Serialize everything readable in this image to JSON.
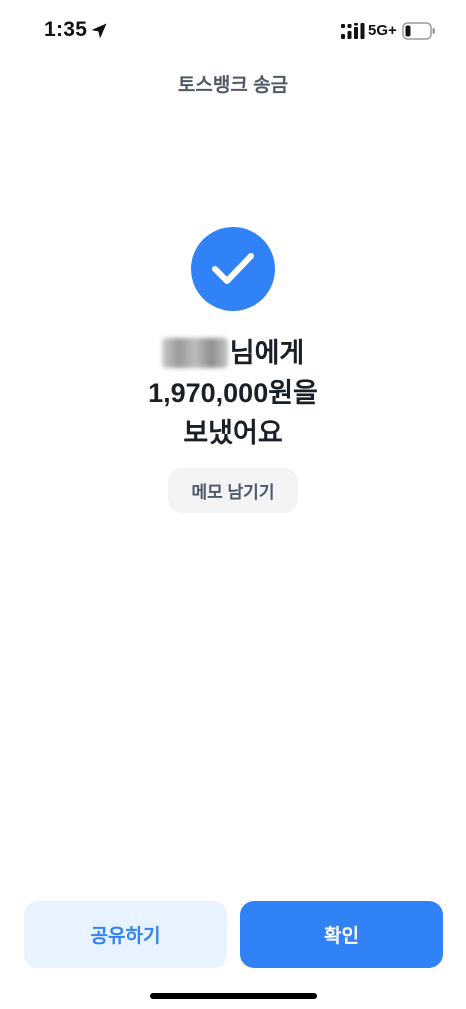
{
  "status_bar": {
    "time": "1:35",
    "network": "5G+",
    "battery_level": 0.2,
    "location_icon": "location-arrow-icon",
    "signal_icon": "cellular-signal-icon",
    "battery_icon": "battery-low-icon"
  },
  "header": {
    "title": "토스뱅크 송금"
  },
  "success": {
    "icon": "check-icon",
    "recipient_name": "",
    "recipient_suffix": "님에게",
    "amount": "1,970,000원을",
    "sent_text": "보냈어요"
  },
  "actions": {
    "memo_label": "메모 남기기",
    "share_label": "공유하기",
    "confirm_label": "확인"
  },
  "colors": {
    "accent": "#3182f6",
    "accent_light": "#e8f3ff",
    "memo_bg": "#f2f4f6",
    "title_text": "#4e5968",
    "body_text": "#191f28"
  }
}
